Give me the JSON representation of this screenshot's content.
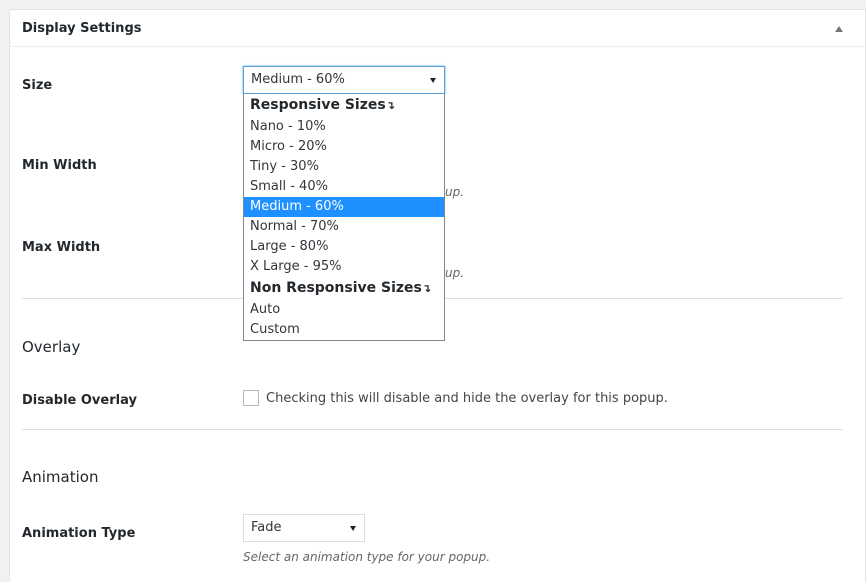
{
  "panel": {
    "title": "Display Settings"
  },
  "size": {
    "label": "Size",
    "selected": "Medium - 60%",
    "options": [
      {
        "label": "Responsive Sizes",
        "group": true
      },
      {
        "label": "Nano - 10%"
      },
      {
        "label": "Micro - 20%"
      },
      {
        "label": "Tiny - 30%"
      },
      {
        "label": "Small - 40%"
      },
      {
        "label": "Medium - 60%",
        "selected": true
      },
      {
        "label": "Normal - 70%"
      },
      {
        "label": "Large - 80%"
      },
      {
        "label": "X Large - 95%"
      },
      {
        "label": "Non Responsive Sizes",
        "group": true
      },
      {
        "label": "Auto"
      },
      {
        "label": "Custom"
      }
    ]
  },
  "min_width": {
    "label": "Min Width",
    "hint_fragment": "up."
  },
  "max_width": {
    "label": "Max Width",
    "hint_fragment": "up."
  },
  "overlay": {
    "section_title": "Overlay",
    "disable_label": "Disable Overlay",
    "checkbox_text": "Checking this will disable and hide the overlay for this popup.",
    "checked": false
  },
  "animation": {
    "section_title": "Animation",
    "type_label": "Animation Type",
    "type_value": "Fade",
    "type_hint": "Select an animation type for your popup."
  },
  "colors": {
    "selected_option_bg": "#1e90ff",
    "focus_border": "#5b9dd9"
  }
}
